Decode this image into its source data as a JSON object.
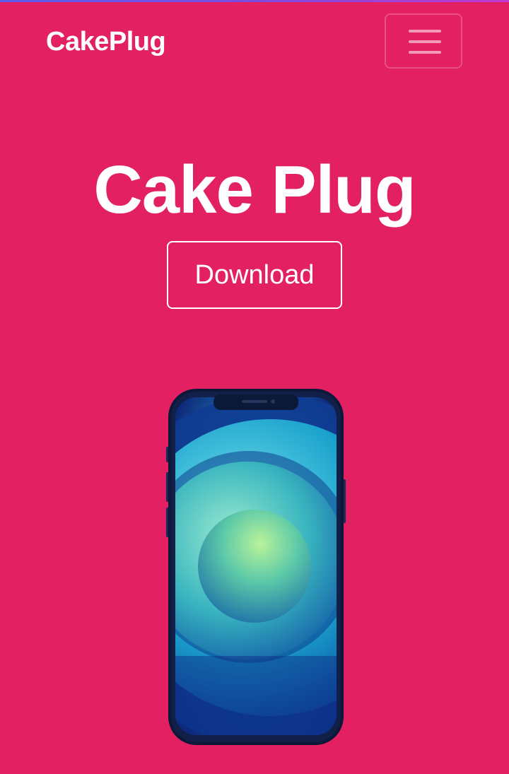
{
  "navbar": {
    "brand": "CakePlug",
    "menu_icon": "hamburger-menu-icon"
  },
  "hero": {
    "title": "Cake Plug",
    "download_label": "Download"
  },
  "colors": {
    "background": "#e32062",
    "text": "#ffffff"
  },
  "image": {
    "semantic": "smartphone-image"
  }
}
